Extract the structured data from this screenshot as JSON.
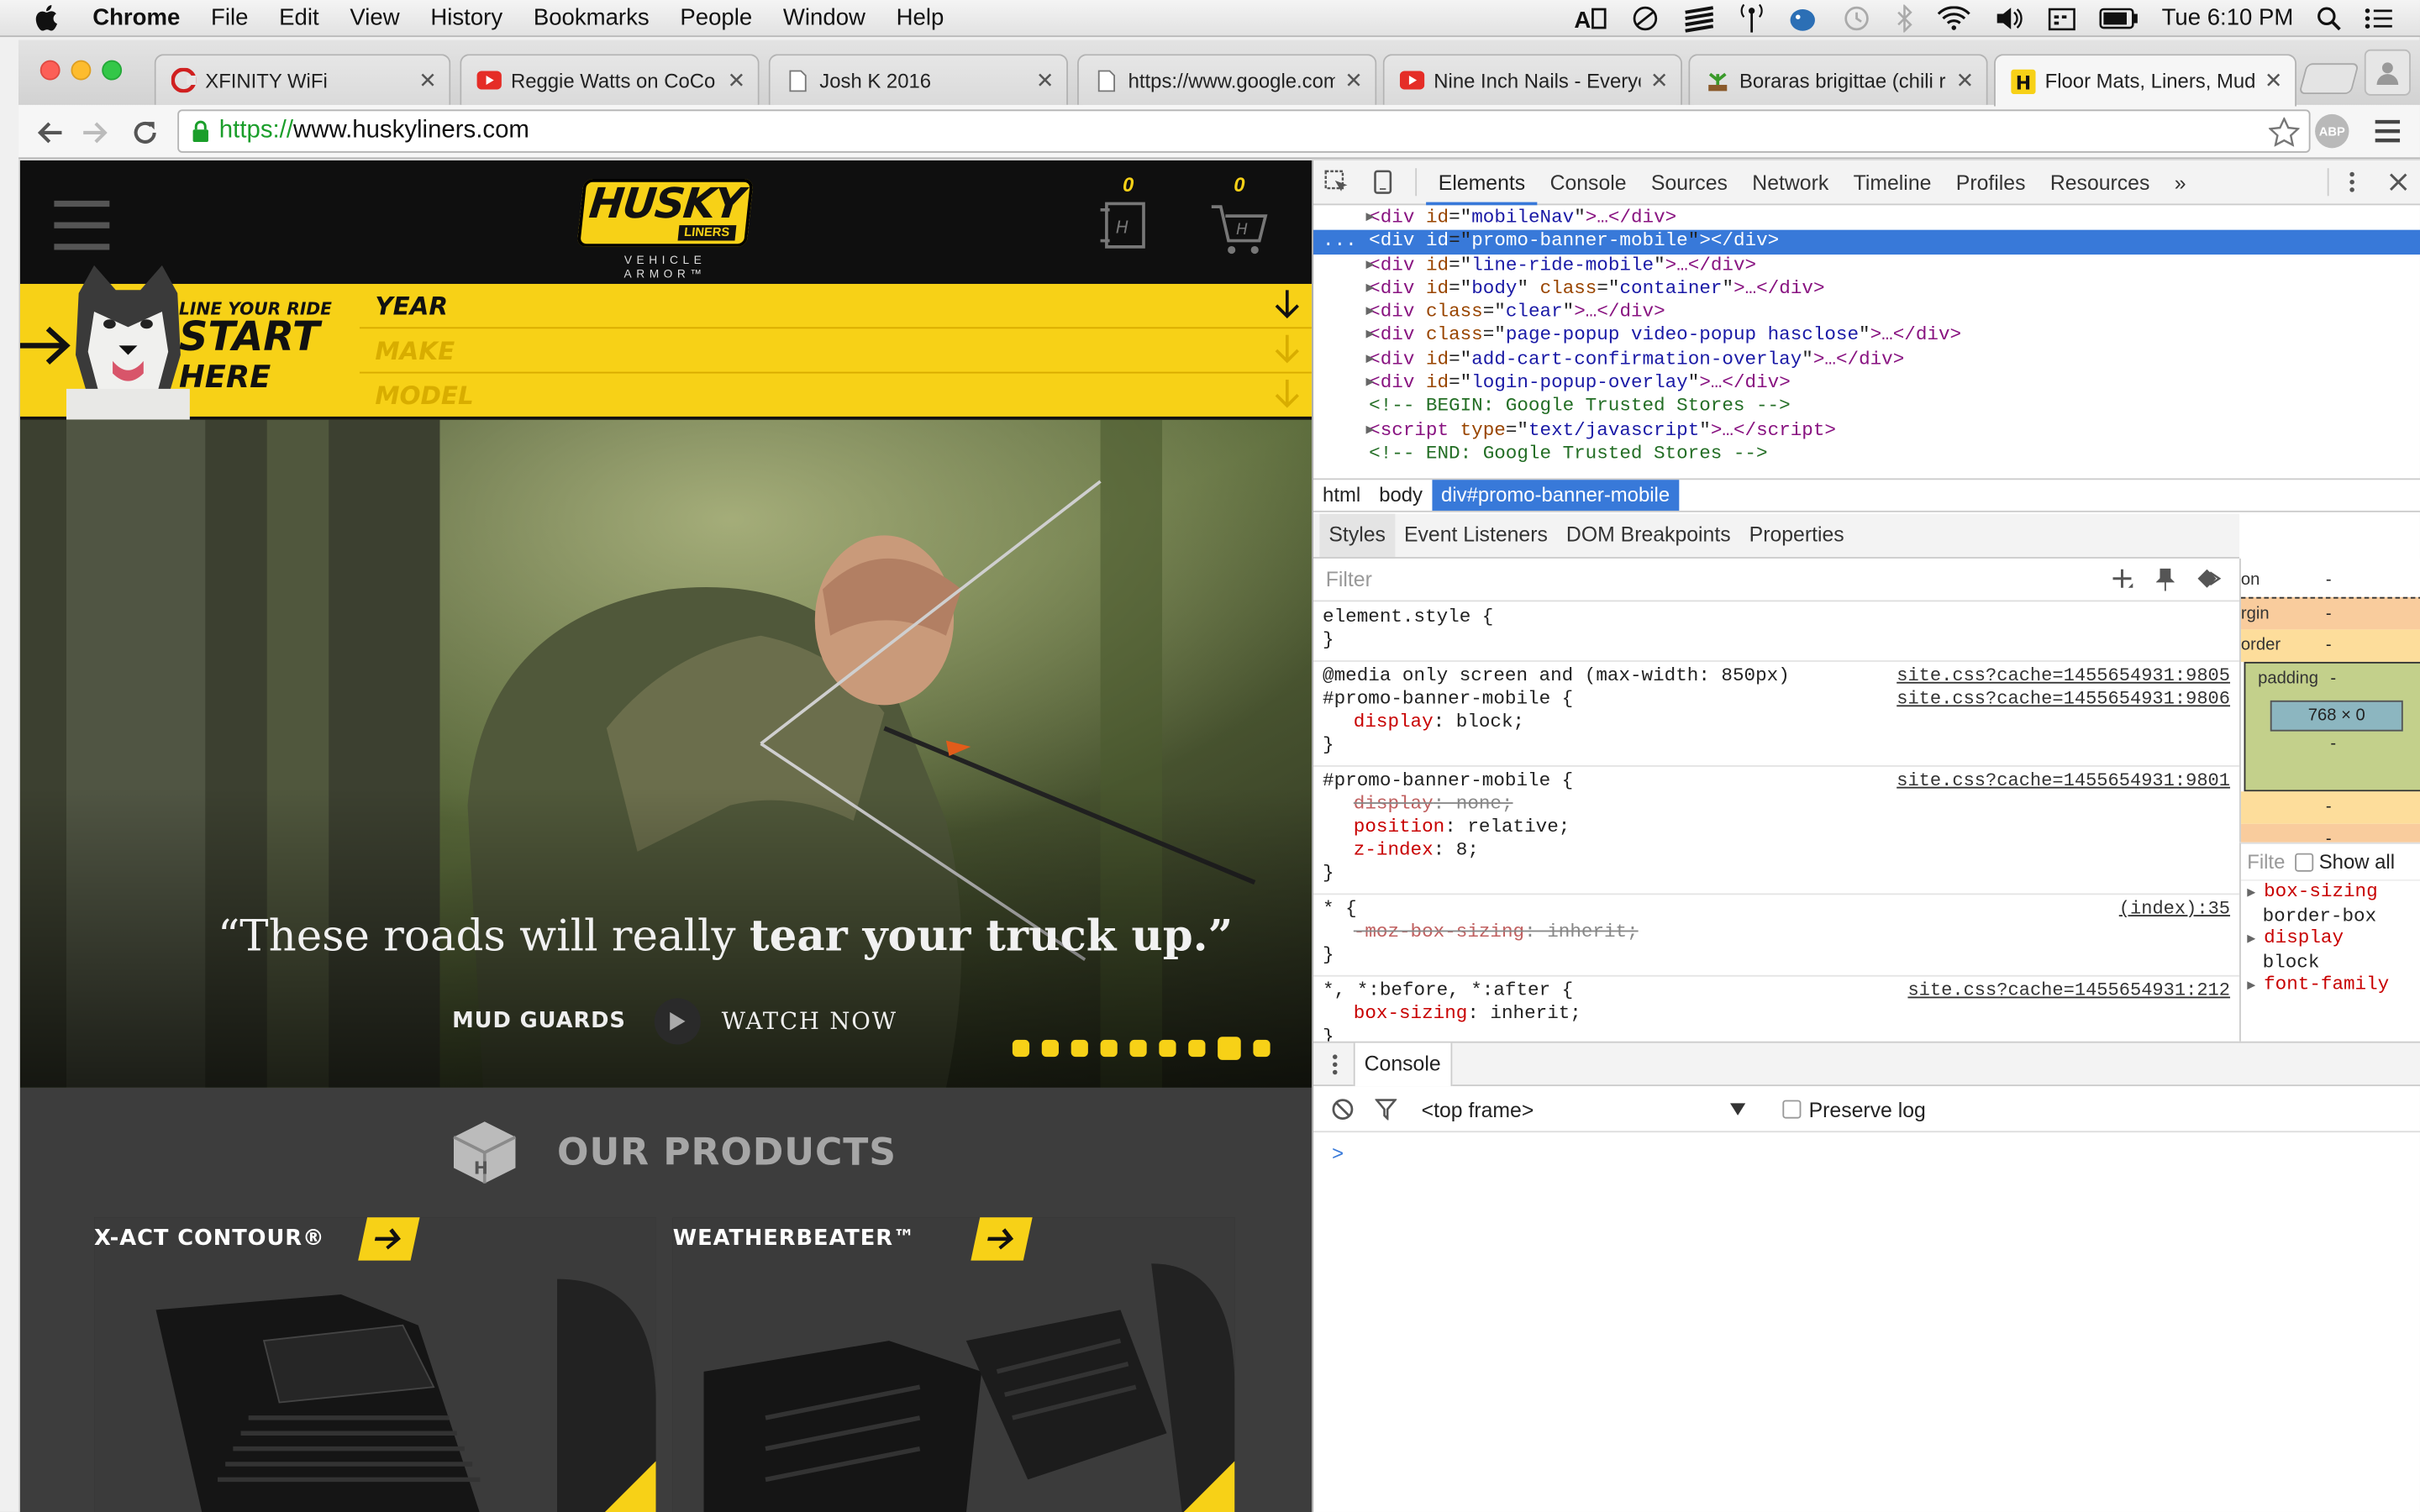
{
  "menubar": {
    "app_name": "Chrome",
    "menus": [
      "File",
      "Edit",
      "View",
      "History",
      "Bookmarks",
      "People",
      "Window",
      "Help"
    ],
    "clock": "Tue 6:10 PM"
  },
  "tabs": [
    {
      "title": "XFINITY WiFi",
      "icon": "comcast-icon"
    },
    {
      "title": "Reggie Watts on CoCo",
      "icon": "youtube-icon"
    },
    {
      "title": "Josh K 2016",
      "icon": "document-icon"
    },
    {
      "title": "https://www.google.com",
      "icon": "document-icon"
    },
    {
      "title": "Nine Inch Nails - Everyda",
      "icon": "youtube-icon"
    },
    {
      "title": "Boraras brigittae (chili ra",
      "icon": "plant-icon"
    },
    {
      "title": "Floor Mats, Liners, Mud",
      "icon": "husky-icon",
      "active": true
    }
  ],
  "address_bar": {
    "scheme": "https://",
    "host": "www.huskyliners.com"
  },
  "extension": {
    "label": "ABP"
  },
  "site": {
    "logo_word": "HUSKY",
    "logo_sub": "LINERS",
    "tagline": "VEHICLE ARMOR™",
    "quote_count": "0",
    "cart_count": "0",
    "quote_icon_letter": "H",
    "cart_icon_letter": "H",
    "cta_line1": "LINE YOUR RIDE",
    "cta_line2": "START",
    "cta_line3": "HERE",
    "selectors": [
      "YEAR",
      "MAKE",
      "MODEL"
    ],
    "hero": {
      "quote_start": "“These roads will really ",
      "quote_bold": "tear your truck up.”",
      "product": "MUD GUARDS",
      "watch": "WATCH NOW",
      "slide_count": 9,
      "active_slide": 7
    },
    "products_heading": "OUR PRODUCTS",
    "products_icon_letter": "H",
    "products": [
      "X-ACT CONTOUR®",
      "WEATHERBEATER™"
    ]
  },
  "devtools": {
    "tabs": [
      "Elements",
      "Console",
      "Sources",
      "Network",
      "Timeline",
      "Profiles",
      "Resources"
    ],
    "active_tab": "Elements",
    "dom": [
      {
        "kind": "el",
        "attrs": [
          [
            "id",
            "mobileNav"
          ]
        ],
        "tail": ">…</div>"
      },
      {
        "kind": "el",
        "attrs": [
          [
            "id",
            "promo-banner-mobile"
          ]
        ],
        "tail": "></div>",
        "selected": true
      },
      {
        "kind": "el",
        "attrs": [
          [
            "id",
            "line-ride-mobile"
          ]
        ],
        "tail": ">…</div>"
      },
      {
        "kind": "el",
        "attrs": [
          [
            "id",
            "body"
          ],
          [
            "class",
            "container"
          ]
        ],
        "tail": ">…</div>"
      },
      {
        "kind": "el",
        "attrs": [
          [
            "class",
            "clear"
          ]
        ],
        "tail": ">…</div>"
      },
      {
        "kind": "el",
        "attrs": [
          [
            "class",
            "page-popup video-popup hasclose"
          ]
        ],
        "tail": ">…</div>"
      },
      {
        "kind": "el",
        "attrs": [
          [
            "id",
            "add-cart-confirmation-overlay"
          ]
        ],
        "tail": ">…</div>"
      },
      {
        "kind": "el",
        "attrs": [
          [
            "id",
            "login-popup-overlay"
          ]
        ],
        "tail": ">…</div>"
      },
      {
        "kind": "comment",
        "text": "<!-- BEGIN: Google Trusted Stores -->"
      },
      {
        "kind": "script",
        "text": "text/javascript"
      },
      {
        "kind": "comment",
        "text": "<!-- END: Google Trusted Stores -->"
      }
    ],
    "breadcrumbs": [
      "html",
      "body",
      "div#promo-banner-mobile"
    ],
    "sub_tabs": [
      "Styles",
      "Event Listeners",
      "DOM Breakpoints",
      "Properties"
    ],
    "filter_placeholder": "Filter",
    "rules": [
      {
        "selector": "element.style {",
        "src": "",
        "decls": [],
        "close": "}"
      },
      {
        "media": "@media only screen and (max-width: 850px)",
        "media_src": "site.css?cache=1455654931:9805",
        "selector": "#promo-banner-mobile {",
        "src": "site.css?cache=1455654931:9806",
        "decls": [
          {
            "p": "display",
            "v": "block;"
          }
        ],
        "close": "}"
      },
      {
        "selector": "#promo-banner-mobile {",
        "src": "site.css?cache=1455654931:9801",
        "decls": [
          {
            "p": "display",
            "v": "none;",
            "strike": true
          },
          {
            "p": "position",
            "v": "relative;"
          },
          {
            "p": "z-index",
            "v": "8;"
          }
        ],
        "close": "}"
      },
      {
        "selector": "* {",
        "src": "(index):35",
        "decls": [
          {
            "p": "-moz-box-sizing",
            "v": "inherit;",
            "strike": true
          }
        ],
        "close": "}"
      },
      {
        "selector": "*, *:before, *:after {",
        "src": "site.css?cache=1455654931:212",
        "decls": [
          {
            "p": "box-sizing",
            "v": "inherit;"
          }
        ],
        "close": "}"
      }
    ],
    "box_model": {
      "labels": [
        "on",
        "rgin",
        "order"
      ],
      "padding_label": "padding",
      "content": "768 × 0",
      "dash": "-"
    },
    "computed": {
      "filter_placeholder": "Filte",
      "show_all": "Show all",
      "props": [
        {
          "n": "box-sizing",
          "v": "border-box"
        },
        {
          "n": "display",
          "v": "block"
        },
        {
          "n": "font-family",
          "v": ""
        }
      ]
    },
    "drawer_tab": "Console",
    "console": {
      "frame": "<top frame>",
      "preserve_log": "Preserve log",
      "prompt": ">"
    }
  },
  "colors": {
    "husky_yellow": "#f7d117",
    "devtools_blue": "#3879d9",
    "secure_green": "#1a9e2a"
  }
}
